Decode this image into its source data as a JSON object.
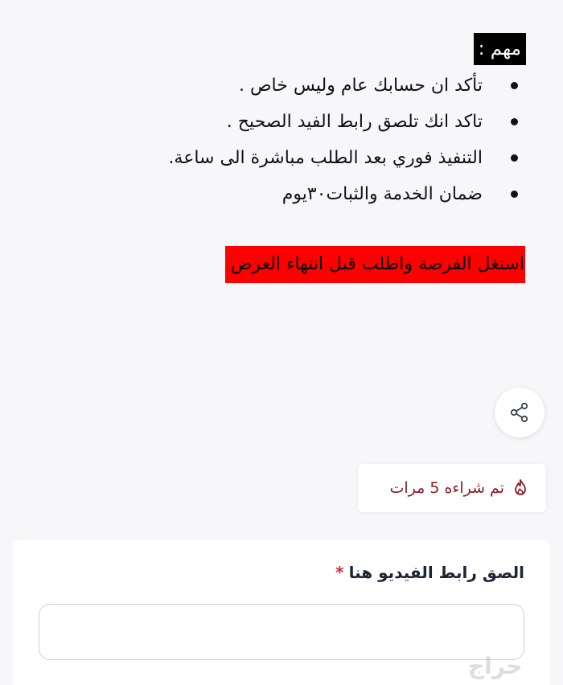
{
  "notice": {
    "label": "مهم :",
    "items": [
      "تأكد ان حسابك عام وليس خاص .",
      "تاكد انك تلصق رابط الفيد الصحيح .",
      "التنفيذ فوري بعد الطلب مباشرة الى ساعة.",
      "ضمان الخدمة والثبات٣٠يوم"
    ]
  },
  "offer": {
    "text": "استغل الفرصة واطلب قبل انتهاء العرض",
    "background_color": "#ff0000"
  },
  "share": {
    "icon": "share-icon"
  },
  "purchase": {
    "icon": "fire-icon",
    "text": "تم شراءه 5 مرات",
    "color": "#8c1c22"
  },
  "form": {
    "label": "الصق رابط الفيديو هنا",
    "required_mark": "*",
    "input_value": "",
    "required_color": "#d9263b"
  },
  "watermark": {
    "text": "حراج"
  }
}
